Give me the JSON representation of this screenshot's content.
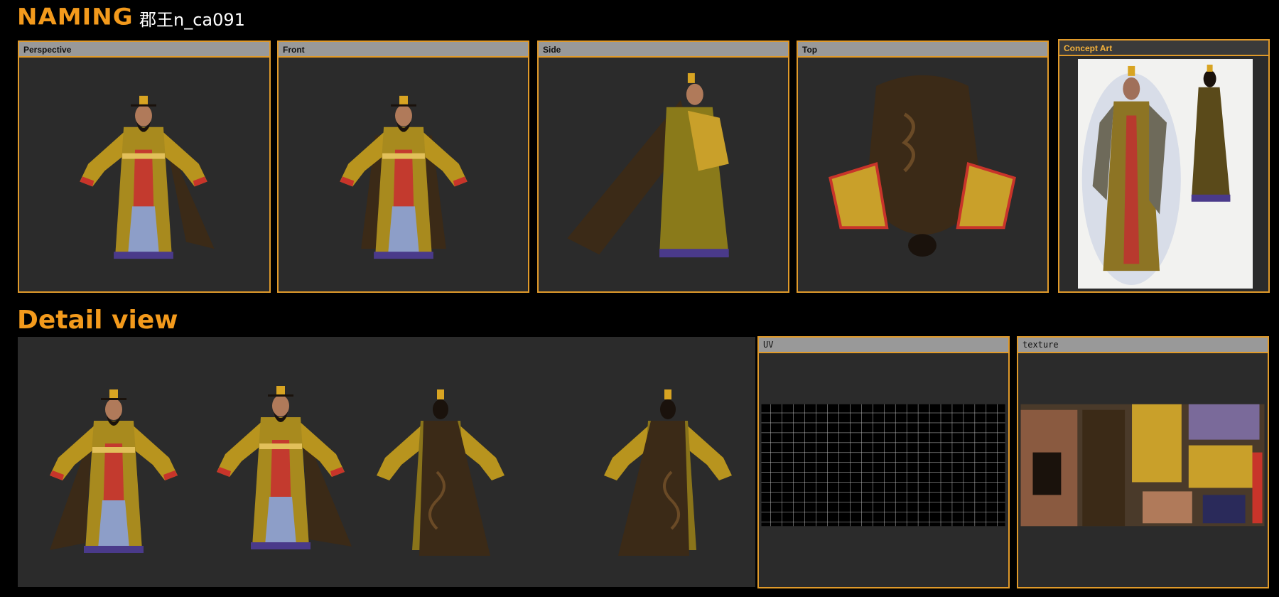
{
  "header": {
    "naming_label": "NAMING",
    "model_code": "郡王n_ca091"
  },
  "views": {
    "perspective": "Perspective",
    "front": "Front",
    "side": "Side",
    "top": "Top",
    "concept": "Concept Art"
  },
  "detail": {
    "title": "Detail view",
    "uv_label": "UV",
    "texture_label": "texture"
  },
  "colors": {
    "accent": "#f39a1c",
    "frame": "#e09a2a",
    "robe": "#c9a02a",
    "cape": "#3b2a17",
    "header_bar": "#999999"
  }
}
